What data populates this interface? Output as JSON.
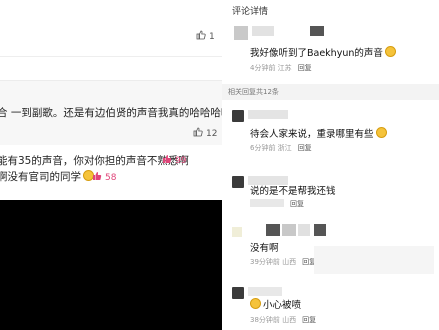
{
  "left": {
    "top_like_count": "1",
    "mid_text": "合 一到副歌。还是有边伯贤的声音我真的哈哈哈哈哈哈哈",
    "mid_like_count": "12",
    "line1": "能有35的声音，你对你担的声音不熟悉啊",
    "line1_likes": "99",
    "line2": "啊没有官司的同学",
    "line2_likes": "58"
  },
  "right": {
    "header": "评论详情",
    "main_comment": "我好像听到了Baekhyun的声音",
    "main_meta": "4分钟前 江苏",
    "section_label": "相关回复共12条",
    "replies": [
      {
        "text": "待会人家来说，重录哪里有些",
        "meta": "6分钟前 浙江"
      },
      {
        "text": "说的是不是帮我还钱",
        "meta": ""
      },
      {
        "text": "没有啊",
        "meta": "39分钟前 山西"
      },
      {
        "text": "小心被喷",
        "meta": "38分钟前 山西"
      }
    ],
    "reply_label": "回复",
    "reply_label2": "回复",
    "reply_label3": "回复",
    "reply_label4": "回复",
    "reply_label5": "回复"
  }
}
